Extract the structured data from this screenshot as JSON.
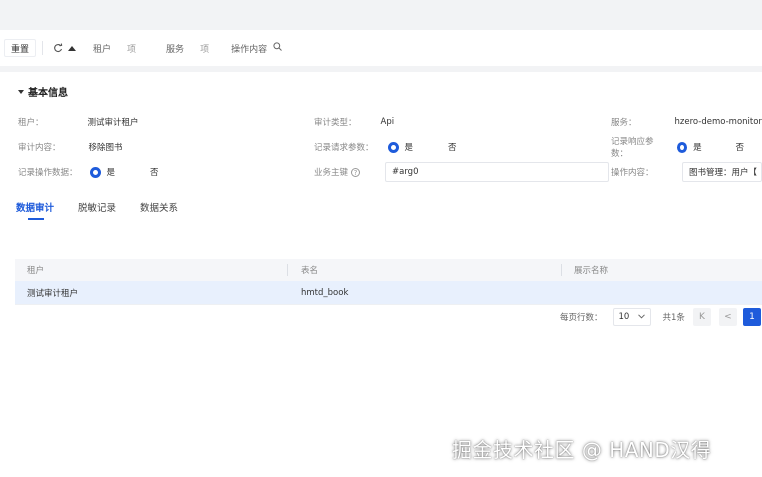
{
  "toolbar": {
    "reset_label": "重置",
    "filters": [
      {
        "label": "租户",
        "value": "项"
      },
      {
        "label": "服务",
        "value": "项"
      }
    ],
    "op_content_label": "操作内容"
  },
  "section": {
    "title": "基本信息",
    "row1": {
      "tenant_label": "租户：",
      "tenant_value": "测试审计租户",
      "audit_type_label": "审计类型：",
      "audit_type_value": "Api",
      "service_label": "服务：",
      "service_value": "hzero-demo-monitor"
    },
    "row2": {
      "audit_content_label": "审计内容：",
      "audit_content_value": "移除图书",
      "record_req_label": "记录请求参数：",
      "record_resp_label": "记录响应参数："
    },
    "row3": {
      "record_op_label": "记录操作数据：",
      "biz_key_label": "业务主键",
      "biz_key_value": "#arg0",
      "op_content_label": "操作内容：",
      "op_content_value": "图书管理：用户【"
    },
    "radio_yes": "是",
    "radio_no": "否"
  },
  "tabs": [
    {
      "label": "数据审计",
      "active": true
    },
    {
      "label": "脱敏记录",
      "active": false
    },
    {
      "label": "数据关系",
      "active": false
    }
  ],
  "table": {
    "columns": [
      "租户",
      "表名",
      "展示名称"
    ],
    "rows": [
      {
        "tenant": "测试审计租户",
        "table_name": "hmtd_book",
        "display_name": ""
      }
    ]
  },
  "pager": {
    "page_size_label": "每页行数：",
    "page_size": "10",
    "total": "共1条",
    "prev_first": "K",
    "prev": "<",
    "current": "1"
  },
  "watermark": "掘金技术社区 @ HAND汉得",
  "colors": {
    "accent": "#1e5bdb",
    "selected_row": "#e8f0fd",
    "page_bg": "#f2f3f5"
  }
}
